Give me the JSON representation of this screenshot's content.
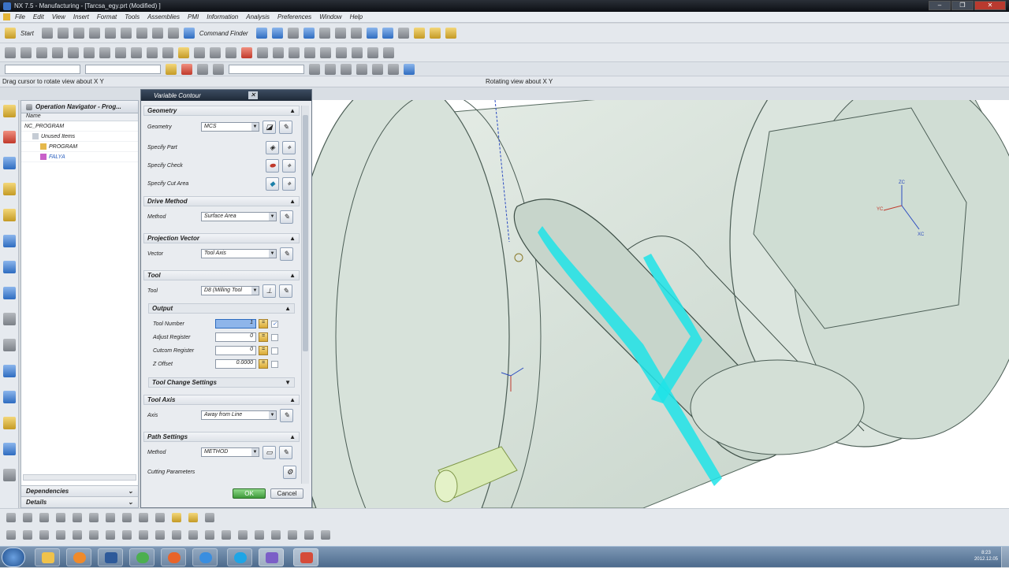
{
  "window": {
    "title": "NX 7.5 - Manufacturing - [Tarcsa_egy.prt (Modified) ]",
    "controls": [
      "–",
      "❐",
      "✕"
    ]
  },
  "menu": [
    "File",
    "Edit",
    "View",
    "Insert",
    "Format",
    "Tools",
    "Assemblies",
    "PMI",
    "Information",
    "Analysis",
    "Preferences",
    "Window",
    "Help"
  ],
  "toolbar": {
    "start": "Start",
    "command_finder": "Command Finder"
  },
  "status": {
    "cue": "Drag cursor to rotate view about  X Y",
    "status": "Rotating view about  X Y"
  },
  "nav": {
    "title": "Operation Navigator - Prog...",
    "column": "Name",
    "rows": [
      "NC_PROGRAM",
      "Unused Items",
      "PROGRAM",
      "FALYA"
    ],
    "footer": [
      "Dependencies",
      "Details"
    ]
  },
  "dialog": {
    "title": "Variable Contour",
    "groups": {
      "geometry": "Geometry",
      "drive": "Drive Method",
      "projection": "Projection Vector",
      "tool": "Tool",
      "output": "Output",
      "toolchange": "Tool Change Settings",
      "toolaxis": "Tool Axis",
      "path": "Path Settings"
    },
    "labels": {
      "geometry": "Geometry",
      "part": "Specify Part",
      "check": "Specify Check",
      "cutarea": "Specify Cut Area",
      "method": "Method",
      "vector": "Vector",
      "tool": "Tool",
      "toolnum": "Tool Number",
      "adjust": "Adjust Register",
      "cutcom": "Cutcom Register",
      "zoffset": "Z Offset",
      "axis": "Axis",
      "pathmethod": "Method",
      "cutting": "Cutting Parameters"
    },
    "values": {
      "geometry": "MCS",
      "method": "Surface Area",
      "vector": "Tool Axis",
      "tool": "D8 (Milling Tool",
      "toolnum": "1",
      "adjust": "0",
      "cutcom": "0",
      "zoffset": "0.0000",
      "axis": "Away from Line",
      "pathmethod": "METHOD"
    },
    "ok": "OK",
    "cancel": "Cancel"
  },
  "triads": {
    "zc": "ZC",
    "yc": "YC",
    "xc": "XC"
  },
  "taskbar": {
    "clock_time": "8:23",
    "clock_date": "2012.12.05"
  },
  "colors": {
    "toolpath": "#1fe3e8",
    "part_fill": "#d6e3d9",
    "part_edge": "#4b5d55",
    "selection": "#8eb5ea"
  }
}
